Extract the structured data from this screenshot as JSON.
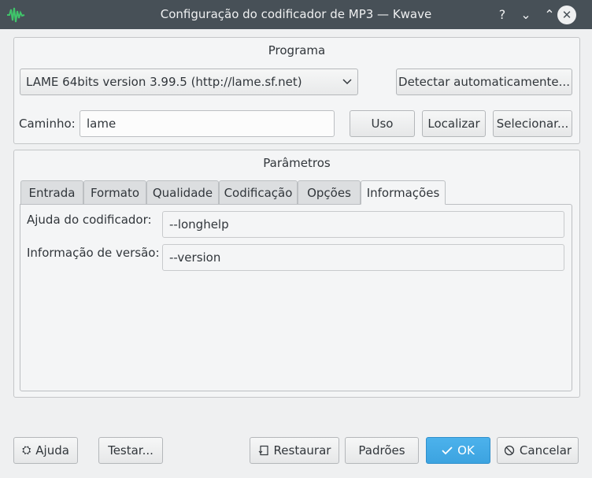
{
  "window": {
    "title": "Configuração do codificador de MP3 — Kwave",
    "help_glyph": "?",
    "minimize_glyph": "⌄",
    "maximize_glyph": "⌃",
    "close_glyph": "✕"
  },
  "programa": {
    "title": "Programa",
    "selected_program": "LAME 64bits version 3.99.5 (http://lame.sf.net)",
    "detect_label": "Detectar automaticamente...",
    "path_label": "Caminho:",
    "path_value": "lame",
    "uso_label": "Uso",
    "localizar_label": "Localizar",
    "selecionar_label": "Selecionar..."
  },
  "parametros": {
    "title": "Parâmetros",
    "tabs": [
      "Entrada",
      "Formato",
      "Qualidade",
      "Codificação",
      "Opções",
      "Informações"
    ],
    "active_tab": "Informações",
    "help_label": "Ajuda do codificador:",
    "help_value": "--longhelp",
    "version_label": "Informação de versão:",
    "version_value": "--version"
  },
  "footer": {
    "ajuda_label": "Ajuda",
    "testar_label": "Testar...",
    "restaurar_label": "Restaurar",
    "padroes_label": "Padrões",
    "ok_label": "OK",
    "cancelar_label": "Cancelar"
  },
  "colors": {
    "titlebar": "#475057",
    "window_bg": "#eff0f1",
    "accent": "#3daee9"
  }
}
